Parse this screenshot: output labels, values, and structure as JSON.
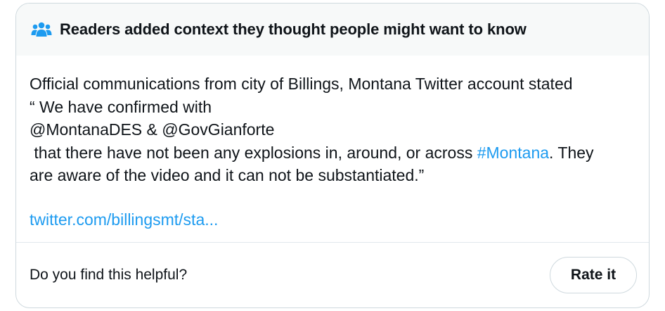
{
  "header": {
    "title": "Readers added context they thought people might want to know",
    "icon": "people-group-icon",
    "icon_color": "#1d9bf0"
  },
  "note": {
    "line1": "Official communications from city of Billings, Montana Twitter account stated",
    "line2": "“ We have confirmed with",
    "line3": "@MontanaDES & @GovGianforte",
    "line4_before": " that there have not been any explosions in, around, or across ",
    "hashtag": "#Montana",
    "line4_after": ". They",
    "line5": "are aware of the video and it can not be substantiated.”",
    "link": "twitter.com/billingsmt/sta..."
  },
  "footer": {
    "question": "Do you find this helpful?",
    "rate_label": "Rate it"
  },
  "colors": {
    "accent": "#1d9bf0",
    "header_bg": "#f7f9f9",
    "border": "#cfd9de",
    "text": "#0f1419"
  }
}
